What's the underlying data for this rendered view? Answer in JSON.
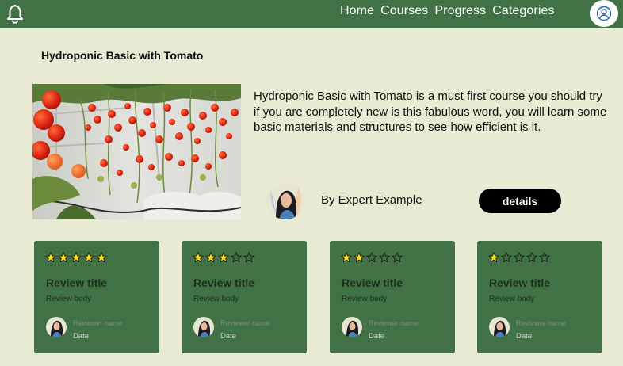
{
  "nav": {
    "links": [
      "Home",
      "Courses",
      "Progress",
      "Categories"
    ],
    "bell_icon": "bell-icon",
    "profile_icon": "user-circle-icon"
  },
  "course": {
    "title": "Hydroponic Basic with Tomato",
    "description": "Hydroponic Basic with Tomato is a must first course you should try if you are completely new is this fabulous word, you will learn some basic materials and structures to see how efficient is it.",
    "author": "By Expert Example",
    "details_label": "details"
  },
  "reviews": [
    {
      "rating": 5,
      "title": "Review title",
      "body": "Review body",
      "reviewer": "Reviewer name",
      "date": "Date"
    },
    {
      "rating": 3,
      "title": "Review title",
      "body": "Review body",
      "reviewer": "Reviewer name",
      "date": "Date"
    },
    {
      "rating": 2,
      "title": "Review title",
      "body": "Review body",
      "reviewer": "Reviewer name",
      "date": "Date"
    },
    {
      "rating": 1,
      "title": "Review title",
      "body": "Review body",
      "reviewer": "Reviewer name",
      "date": "Date"
    }
  ],
  "colors": {
    "background": "#e8ead3",
    "brand_green": "#417246",
    "star_filled": "#f5e11b",
    "button": "#000000"
  }
}
